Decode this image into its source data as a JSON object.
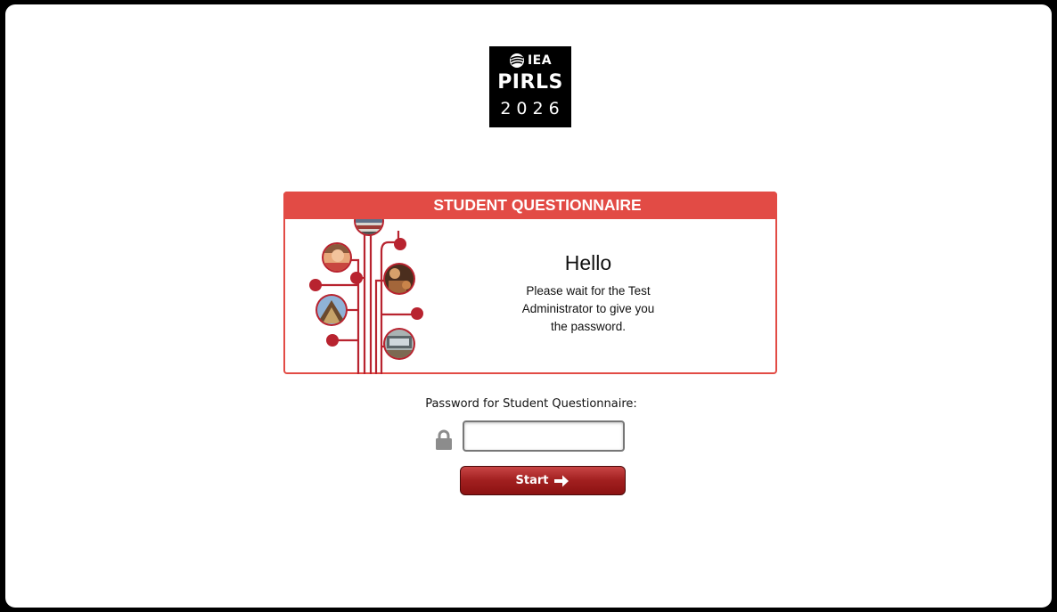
{
  "logo": {
    "org": "IEA",
    "program": "PIRLS",
    "year": "2026"
  },
  "card": {
    "title": "STUDENT QUESTIONNAIRE",
    "greeting": "Hello",
    "message_lines": [
      "Please wait for the Test",
      "Administrator to give you",
      "the password."
    ]
  },
  "form": {
    "password_label": "Password for Student Questionnaire:",
    "password_value": "",
    "start_label": "Start"
  },
  "icons": {
    "lock": "lock-icon",
    "arrow": "arrow-right-icon",
    "globe": "globe-icon"
  },
  "colors": {
    "accent": "#e24b45",
    "branch": "#b8232f",
    "button": "#a11f1f"
  }
}
